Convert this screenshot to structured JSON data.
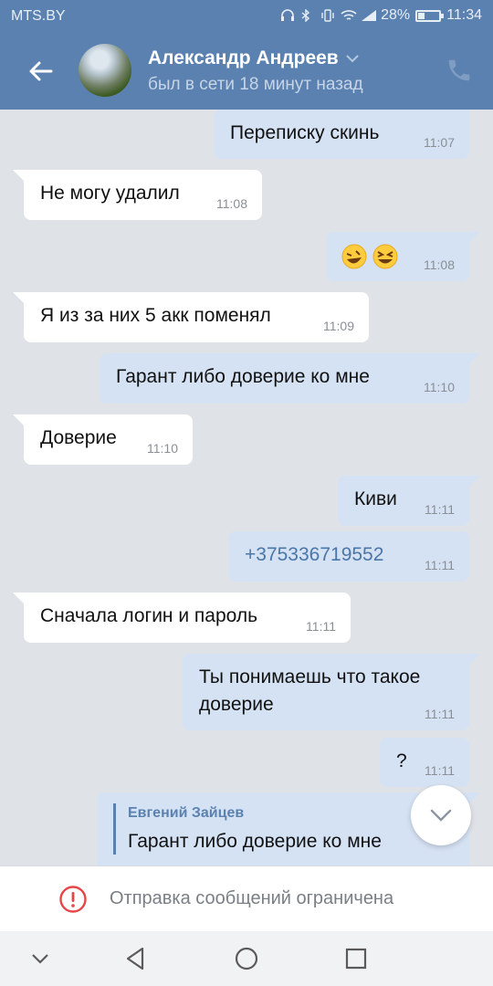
{
  "status_bar": {
    "carrier": "MTS.BY",
    "battery": "28%",
    "time": "11:34"
  },
  "header": {
    "name": "Александр Андреев",
    "last_seen": "был в сети 18 минут назад"
  },
  "messages": [
    {
      "dir": "out",
      "text": "Переписку скинь",
      "time": "11:07"
    },
    {
      "dir": "in",
      "text": "Не могу удалил",
      "time": "11:08"
    },
    {
      "dir": "out",
      "text": "🤣😆",
      "time": "11:08"
    },
    {
      "dir": "in",
      "text": "Я из за них 5 акк поменял",
      "time": "11:09"
    },
    {
      "dir": "out",
      "text": "Гарант либо доверие ко мне",
      "time": "11:10"
    },
    {
      "dir": "in",
      "text": "Доверие",
      "time": "11:10"
    },
    {
      "dir": "out",
      "text": "Киви",
      "time": "11:11"
    },
    {
      "dir": "out",
      "text": "+375336719552",
      "time": "11:11"
    },
    {
      "dir": "in",
      "text": "Сначала логин и пароль",
      "time": "11:11"
    },
    {
      "dir": "out",
      "text": "Ты понимаешь что такое",
      "text2": "доверие",
      "time": "11:11"
    },
    {
      "dir": "out",
      "text": "?",
      "time": "11:11"
    }
  ],
  "reply": {
    "author": "Евгений Зайцев",
    "quote": "Гарант либо доверие ко мне"
  },
  "restricted": {
    "label": "Отправка сообщений ограничена"
  },
  "colors": {
    "header": "#5b81b0",
    "out_bubble": "#d5e2f3",
    "in_bubble": "#ffffff",
    "chat_bg": "#dfe3e8",
    "link": "#4a76a8",
    "warn": "#e64646"
  }
}
